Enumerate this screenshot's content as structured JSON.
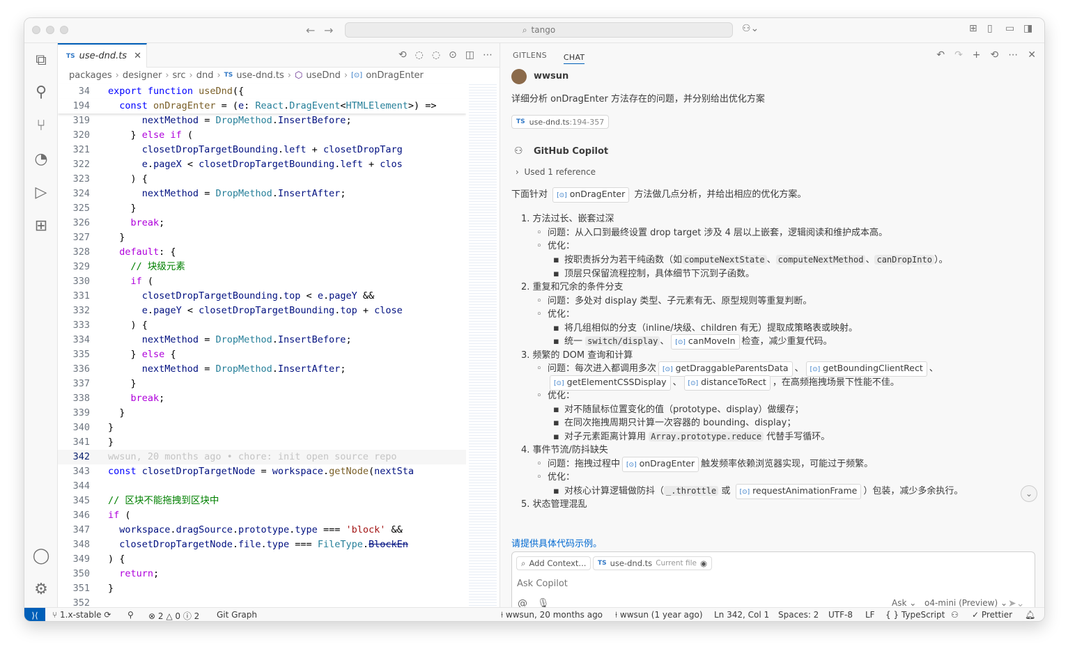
{
  "titlebar": {
    "search": "tango"
  },
  "tab": {
    "badge": "TS",
    "name": "use-dnd.ts"
  },
  "breadcrumb": [
    "packages",
    "designer",
    "src",
    "dnd",
    "use-dnd.ts",
    "useDnd",
    "onDragEnter"
  ],
  "sticky": [
    {
      "n": "34",
      "html": "<span class='k'>export</span> <span class='k'>function</span> <span class='f'>useDnd</span><span class='p'>({</span>"
    },
    {
      "n": "194",
      "html": "  <span class='k'>const</span> <span class='f'>onDragEnter</span> <span class='p'>= (</span><span class='v'>e</span><span class='p'>:</span> <span class='t'>React</span><span class='p'>.</span><span class='t'>DragEvent</span><span class='p'>&lt;</span><span class='t'>HTMLElement</span><span class='p'>&gt;) =&gt;</span>"
    }
  ],
  "lines": [
    {
      "n": "319",
      "html": "      <span class='v'>nextMethod</span> <span class='p'>=</span> <span class='t'>DropMethod</span><span class='p'>.</span><span class='v'>InsertBefore</span><span class='p'>;</span>"
    },
    {
      "n": "320",
      "html": "    <span class='p'>}</span> <span class='ctl'>else if</span> <span class='p'>(</span>"
    },
    {
      "n": "321",
      "html": "      <span class='v'>closetDropTargetBounding</span><span class='p'>.</span><span class='v'>left</span> <span class='p'>+</span> <span class='v'>closetDropTarg</span>"
    },
    {
      "n": "322",
      "html": "      <span class='v'>e</span><span class='p'>.</span><span class='v'>pageX</span> <span class='p'>&lt;</span> <span class='v'>closetDropTargetBounding</span><span class='p'>.</span><span class='v'>left</span> <span class='p'>+</span> <span class='v'>clos</span>"
    },
    {
      "n": "323",
      "html": "    <span class='p'>) {</span>"
    },
    {
      "n": "324",
      "html": "      <span class='v'>nextMethod</span> <span class='p'>=</span> <span class='t'>DropMethod</span><span class='p'>.</span><span class='v'>InsertAfter</span><span class='p'>;</span>"
    },
    {
      "n": "325",
      "html": "    <span class='p'>}</span>"
    },
    {
      "n": "326",
      "html": "    <span class='ctl'>break</span><span class='p'>;</span>"
    },
    {
      "n": "327",
      "html": "  <span class='p'>}</span>"
    },
    {
      "n": "328",
      "html": "  <span class='ctl'>default</span><span class='p'>: {</span>"
    },
    {
      "n": "329",
      "html": "    <span class='c'>// 块级元素</span>"
    },
    {
      "n": "330",
      "html": "    <span class='ctl'>if</span> <span class='p'>(</span>"
    },
    {
      "n": "331",
      "html": "      <span class='v'>closetDropTargetBounding</span><span class='p'>.</span><span class='v'>top</span> <span class='p'>&lt;</span> <span class='v'>e</span><span class='p'>.</span><span class='v'>pageY</span> <span class='p'>&amp;&amp;</span>"
    },
    {
      "n": "332",
      "html": "      <span class='v'>e</span><span class='p'>.</span><span class='v'>pageY</span> <span class='p'>&lt;</span> <span class='v'>closetDropTargetBounding</span><span class='p'>.</span><span class='v'>top</span> <span class='p'>+</span> <span class='v'>close</span>"
    },
    {
      "n": "333",
      "html": "    <span class='p'>) {</span>"
    },
    {
      "n": "334",
      "html": "      <span class='v'>nextMethod</span> <span class='p'>=</span> <span class='t'>DropMethod</span><span class='p'>.</span><span class='v'>InsertBefore</span><span class='p'>;</span>"
    },
    {
      "n": "335",
      "html": "    <span class='p'>}</span> <span class='ctl'>else</span> <span class='p'>{</span>"
    },
    {
      "n": "336",
      "html": "      <span class='v'>nextMethod</span> <span class='p'>=</span> <span class='t'>DropMethod</span><span class='p'>.</span><span class='v'>InsertAfter</span><span class='p'>;</span>"
    },
    {
      "n": "337",
      "html": "    <span class='p'>}</span>"
    },
    {
      "n": "338",
      "html": "    <span class='ctl'>break</span><span class='p'>;</span>"
    },
    {
      "n": "339",
      "html": "  <span class='p'>}</span>"
    },
    {
      "n": "340",
      "html": "<span class='p'>}</span>"
    },
    {
      "n": "341",
      "html": "<span class='p'>}</span>"
    },
    {
      "n": "342",
      "html": "<span class='ghost'>wwsun, 20 months ago • chore: init open source repo</span>",
      "current": true
    },
    {
      "n": "343",
      "html": "<span class='k'>const</span> <span class='v'>closetDropTargetNode</span> <span class='p'>=</span> <span class='v'>workspace</span><span class='p'>.</span><span class='f'>getNode</span><span class='p'>(</span><span class='v'>nextSta</span>"
    },
    {
      "n": "344",
      "html": ""
    },
    {
      "n": "345",
      "html": "<span class='c'>// 区块不能拖拽到区块中</span>"
    },
    {
      "n": "346",
      "html": "<span class='ctl'>if</span> <span class='p'>(</span>"
    },
    {
      "n": "347",
      "html": "  <span class='v'>workspace</span><span class='p'>.</span><span class='v'>dragSource</span><span class='p'>.</span><span class='v'>prototype</span><span class='p'>.</span><span class='v'>type</span> <span class='p'>===</span> <span class='s'>'block'</span> <span class='p'>&amp;&amp;</span>"
    },
    {
      "n": "348",
      "html": "  <span class='v'>closetDropTargetNode</span><span class='p'>.</span><span class='v'>file</span><span class='p'>.</span><span class='v'>type</span> <span class='p'>===</span> <span class='t'>FileType</span><span class='p'>.</span><span class='v' style='text-decoration:line-through'>BlockEn</span>"
    },
    {
      "n": "349",
      "html": "<span class='p'>) {</span>"
    },
    {
      "n": "350",
      "html": "  <span class='ctl'>return</span><span class='p'>;</span>"
    },
    {
      "n": "351",
      "html": "<span class='p'>}</span>"
    },
    {
      "n": "352",
      "html": ""
    }
  ],
  "panel": {
    "tabs": [
      "GITLENS",
      "CHAT"
    ]
  },
  "chat": {
    "user": "wwsun",
    "question": "详细分析 onDragEnter 方法存在的问题，并分别给出优化方案",
    "ref_badge": "TS",
    "ref_file": "use-dnd.ts",
    "ref_range": ":194-357",
    "assistant": "GitHub Copilot",
    "used_ref": "Used 1 reference",
    "intro_a": "下面针对",
    "intro_chip": "onDragEnter",
    "intro_b": "方法做几点分析，并给出相应的优化方案。",
    "s1": "1. 方法过长、嵌套过深",
    "s1_q": "问题：从入口到最终设置 drop target 涉及 4 层以上嵌套，逻辑阅读和维护成本高。",
    "opt": "优化：",
    "s1_o1a": "按职责拆分为若干纯函数（如",
    "s1_c1": "computeNextState",
    "s1_c2": "computeNextMethod",
    "s1_c3": "canDropInto",
    "s1_o1b": "）。",
    "s1_o2": "顶层只保留流程控制，具体细节下沉到子函数。",
    "s2": "2. 重复和冗余的条件分支",
    "s2_q": "问题：多处对 display 类型、子元素有无、原型规则等重复判断。",
    "s2_o1": "将几组相似的分支（inline/块级、children 有无）提取成策略表或映射。",
    "s2_o2a": "统一",
    "s2_c1": "switch/display",
    "s2_chip": "canMoveIn",
    "s2_o2b": "检查，减少重复代码。",
    "s3": "3. 频繁的 DOM 查询和计算",
    "s3_qa": "问题：每次进入都调用多次",
    "s3_ch1": "getDraggableParentsData",
    "s3_ch2": "getBoundingClientRect",
    "s3_ch3": "getElementCSSDisplay",
    "s3_ch4": "distanceToRect",
    "s3_qb": "，在高频拖拽场景下性能不佳。",
    "s3_o1": "对不随鼠标位置变化的值（prototype、display）做缓存；",
    "s3_o2": "在同次拖拽周期只计算一次容器的 bounding、display；",
    "s3_o3a": "对子元素距离计算用",
    "s3_c1": "Array.prototype.reduce",
    "s3_o3b": "代替手写循环。",
    "s4": "4. 事件节流/防抖缺失",
    "s4_qa": "问题：拖拽过程中",
    "s4_chip": "onDragEnter",
    "s4_qb": "触发频率依赖浏览器实现，可能过于频繁。",
    "s4_oa": "对核心计算逻辑做防抖（",
    "s4_c1": "_.throttle",
    "s4_or": "或",
    "s4_chip2": "requestAnimationFrame",
    "s4_ob": "）包装，减少多余执行。",
    "s5": "5. 状态管理混乱",
    "followup": "请提供具体代码示例。"
  },
  "input": {
    "add_context": "Add Context...",
    "file_badge": "TS",
    "file": "use-dnd.ts",
    "file_note": "Current file",
    "placeholder": "Ask Copilot",
    "mode": "Ask",
    "model": "o4-mini (Preview)"
  },
  "status": {
    "branch": "1.x-stable",
    "errors": "2",
    "warnings": "0",
    "infos": "2",
    "git_graph": "Git Graph",
    "blame": "wwsun, 20 months ago",
    "author": "wwsun (1 year ago)",
    "position": "Ln 342, Col 1",
    "spaces": "Spaces: 2",
    "encoding": "UTF-8",
    "eol": "LF",
    "language": "TypeScript",
    "prettier": "Prettier"
  }
}
